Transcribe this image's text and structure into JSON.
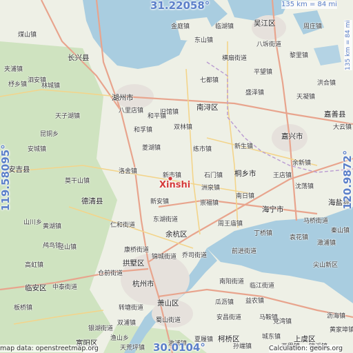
{
  "place": {
    "name": "Xinshi",
    "marker_color": "#d43a3a"
  },
  "coordinates": {
    "lat_top": "31.22058°",
    "lat_bottom": "30.0104°",
    "lon_left": "119.58095°",
    "lon_right": "120.9872°"
  },
  "scale": {
    "top": "135 km = 84 mi",
    "right": "135 km = 84 mi"
  },
  "attribution": {
    "left": "map data: openstreetmap.org",
    "right": "Calculation: geoirs.org"
  },
  "colors": {
    "water": "#a9cde0",
    "land": "#eef0e6",
    "forest": "#cfe3c0",
    "urban": "#e6e1dc",
    "motorway": "#e8a48d",
    "primary": "#f3d48a",
    "coord_text": "#5b7fc9"
  },
  "labels": [
    {
      "text": "金庭镇",
      "kind": "town"
    },
    {
      "text": "临湖镇",
      "kind": "town"
    },
    {
      "text": "吴江区",
      "kind": "district"
    },
    {
      "text": "周庄镇",
      "kind": "town"
    },
    {
      "text": "煤山镇",
      "kind": "town"
    },
    {
      "text": "东山镇",
      "kind": "town"
    },
    {
      "text": "八坼街道",
      "kind": "town"
    },
    {
      "text": "长兴县",
      "kind": "district"
    },
    {
      "text": "横扇街道",
      "kind": "town"
    },
    {
      "text": "黎里镇",
      "kind": "town"
    },
    {
      "text": "夹浦镇",
      "kind": "town"
    },
    {
      "text": "平望镇",
      "kind": "town"
    },
    {
      "text": "泗安镇",
      "kind": "town"
    },
    {
      "text": "杼乡镇",
      "kind": "town"
    },
    {
      "text": "林城镇",
      "kind": "town"
    },
    {
      "text": "七都镇",
      "kind": "town"
    },
    {
      "text": "盛泽镇",
      "kind": "town"
    },
    {
      "text": "洪合镇",
      "kind": "town"
    },
    {
      "text": "湖州市",
      "kind": "city"
    },
    {
      "text": "天凝镇",
      "kind": "town"
    },
    {
      "text": "八里店镇",
      "kind": "town"
    },
    {
      "text": "旧馆镇",
      "kind": "town"
    },
    {
      "text": "南浔区",
      "kind": "district"
    },
    {
      "text": "和平镇",
      "kind": "town"
    },
    {
      "text": "嘉善县",
      "kind": "district"
    },
    {
      "text": "天子湖镇",
      "kind": "town"
    },
    {
      "text": "大云镇",
      "kind": "town"
    },
    {
      "text": "和孚镇",
      "kind": "town"
    },
    {
      "text": "双林镇",
      "kind": "town"
    },
    {
      "text": "昆铜乡",
      "kind": "town"
    },
    {
      "text": "嘉兴市",
      "kind": "city"
    },
    {
      "text": "菱湖镇",
      "kind": "town"
    },
    {
      "text": "练市镇",
      "kind": "town"
    },
    {
      "text": "新生镇",
      "kind": "town"
    },
    {
      "text": "安城镇",
      "kind": "town"
    },
    {
      "text": "余新镇",
      "kind": "town"
    },
    {
      "text": "安吉县",
      "kind": "district"
    },
    {
      "text": "洛舍镇",
      "kind": "town"
    },
    {
      "text": "桐乡市",
      "kind": "district"
    },
    {
      "text": "新市镇",
      "kind": "town"
    },
    {
      "text": "石门镇",
      "kind": "town"
    },
    {
      "text": "王店镇",
      "kind": "town"
    },
    {
      "text": "莫干山镇",
      "kind": "town"
    },
    {
      "text": "沈荡镇",
      "kind": "town"
    },
    {
      "text": "洲泉镇",
      "kind": "town"
    },
    {
      "text": "德清县",
      "kind": "district"
    },
    {
      "text": "南日镇",
      "kind": "town"
    },
    {
      "text": "海盐县",
      "kind": "district"
    },
    {
      "text": "新安镇",
      "kind": "town"
    },
    {
      "text": "崇福镇",
      "kind": "town"
    },
    {
      "text": "海宁市",
      "kind": "district"
    },
    {
      "text": "山川乡",
      "kind": "town"
    },
    {
      "text": "马桥街道",
      "kind": "town"
    },
    {
      "text": "东湖街道",
      "kind": "town"
    },
    {
      "text": "周王庙镇",
      "kind": "town"
    },
    {
      "text": "黄湖镇",
      "kind": "town"
    },
    {
      "text": "仁和街道",
      "kind": "town"
    },
    {
      "text": "秦山镇",
      "kind": "town"
    },
    {
      "text": "余杭区",
      "kind": "district"
    },
    {
      "text": "丁桥镇",
      "kind": "town"
    },
    {
      "text": "袁花镇",
      "kind": "town"
    },
    {
      "text": "鸬鸟镇",
      "kind": "town"
    },
    {
      "text": "澉浦镇",
      "kind": "town"
    },
    {
      "text": "径山镇",
      "kind": "town"
    },
    {
      "text": "康桥街道",
      "kind": "town"
    },
    {
      "text": "乔司街道",
      "kind": "town"
    },
    {
      "text": "前进街道",
      "kind": "town"
    },
    {
      "text": "高虹镇",
      "kind": "town"
    },
    {
      "text": "拱墅区",
      "kind": "district"
    },
    {
      "text": "尖山新区",
      "kind": "town"
    },
    {
      "text": "仓前街道",
      "kind": "town"
    },
    {
      "text": "锦城街道",
      "kind": "town"
    },
    {
      "text": "临安区",
      "kind": "district"
    },
    {
      "text": "中泰街道",
      "kind": "town"
    },
    {
      "text": "杭州市",
      "kind": "city"
    },
    {
      "text": "南阳街道",
      "kind": "town"
    },
    {
      "text": "临江街道",
      "kind": "town"
    },
    {
      "text": "板桥镇",
      "kind": "town"
    },
    {
      "text": "转塘街道",
      "kind": "town"
    },
    {
      "text": "萧山区",
      "kind": "district"
    },
    {
      "text": "瓜沥镇",
      "kind": "town"
    },
    {
      "text": "益农镇",
      "kind": "town"
    },
    {
      "text": "双浦镇",
      "kind": "town"
    },
    {
      "text": "蜀山街道",
      "kind": "town"
    },
    {
      "text": "安昌街道",
      "kind": "town"
    },
    {
      "text": "马鞍镇",
      "kind": "town"
    },
    {
      "text": "银湖街道",
      "kind": "town"
    },
    {
      "text": "党湾镇",
      "kind": "town"
    },
    {
      "text": "沥海镇",
      "kind": "town"
    },
    {
      "text": "黄家埠镇",
      "kind": "town"
    },
    {
      "text": "渔山乡",
      "kind": "town"
    },
    {
      "text": "富阳区",
      "kind": "district"
    },
    {
      "text": "柯桥区",
      "kind": "district"
    },
    {
      "text": "夏履镇",
      "kind": "town"
    },
    {
      "text": "孙端镇",
      "kind": "town"
    },
    {
      "text": "上虞区",
      "kind": "district"
    },
    {
      "text": "锦溪镇",
      "kind": "town"
    },
    {
      "text": "西界镇",
      "kind": "town"
    },
    {
      "text": "天荒坪镇",
      "kind": "town"
    },
    {
      "text": "城东镇",
      "kind": "town"
    },
    {
      "text": "澉浦镇",
      "kind": "town"
    }
  ]
}
